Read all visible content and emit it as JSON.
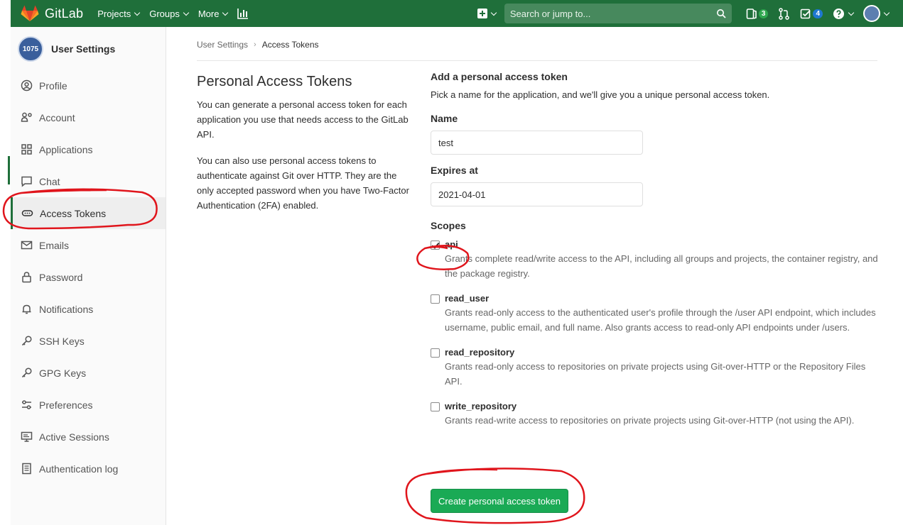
{
  "topbar": {
    "brand": "GitLab",
    "nav": [
      {
        "label": "Projects"
      },
      {
        "label": "Groups"
      },
      {
        "label": "More"
      }
    ],
    "search_placeholder": "Search or jump to...",
    "issues_count": "3",
    "todos_count": "4",
    "bar_color": "#1f6f3a"
  },
  "sidebar": {
    "title": "User Settings",
    "avatar_text": "1075",
    "items": [
      {
        "label": "Profile",
        "icon": "profile-icon"
      },
      {
        "label": "Account",
        "icon": "account-icon"
      },
      {
        "label": "Applications",
        "icon": "applications-icon"
      },
      {
        "label": "Chat",
        "icon": "chat-icon"
      },
      {
        "label": "Access Tokens",
        "icon": "access-tokens-icon",
        "active": true
      },
      {
        "label": "Emails",
        "icon": "email-icon"
      },
      {
        "label": "Password",
        "icon": "lock-icon"
      },
      {
        "label": "Notifications",
        "icon": "bell-icon"
      },
      {
        "label": "SSH Keys",
        "icon": "key-icon"
      },
      {
        "label": "GPG Keys",
        "icon": "key-icon"
      },
      {
        "label": "Preferences",
        "icon": "preferences-icon"
      },
      {
        "label": "Active Sessions",
        "icon": "monitor-icon"
      },
      {
        "label": "Authentication log",
        "icon": "log-icon"
      }
    ]
  },
  "breadcrumb": {
    "parent": "User Settings",
    "current": "Access Tokens"
  },
  "intro": {
    "title": "Personal Access Tokens",
    "para1": "You can generate a personal access token for each application you use that needs access to the GitLab API.",
    "para2": "You can also use personal access tokens to authenticate against Git over HTTP. They are the only accepted password when you have Two-Factor Authentication (2FA) enabled."
  },
  "form": {
    "heading": "Add a personal access token",
    "help": "Pick a name for the application, and we'll give you a unique personal access token.",
    "name_label": "Name",
    "name_value": "test",
    "expires_label": "Expires at",
    "expires_value": "2021-04-01",
    "scopes_label": "Scopes",
    "scopes": [
      {
        "name": "api",
        "checked": true,
        "desc": "Grants complete read/write access to the API, including all groups and projects, the container registry, and the package registry."
      },
      {
        "name": "read_user",
        "checked": false,
        "desc": "Grants read-only access to the authenticated user's profile through the /user API endpoint, which includes username, public email, and full name. Also grants access to read-only API endpoints under /users."
      },
      {
        "name": "read_repository",
        "checked": false,
        "desc": "Grants read-only access to repositories on private projects using Git-over-HTTP or the Repository Files API."
      },
      {
        "name": "write_repository",
        "checked": false,
        "desc": "Grants read-write access to repositories on private projects using Git-over-HTTP (not using the API)."
      }
    ],
    "submit_label": "Create personal access token",
    "submit_color": "#1aaa55"
  },
  "annotation_color": "#e0151c"
}
